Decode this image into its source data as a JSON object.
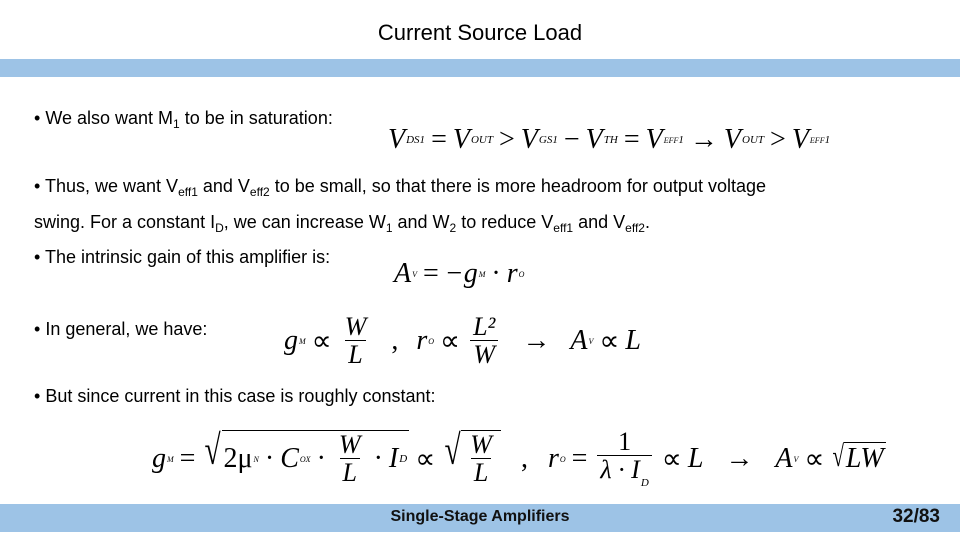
{
  "slide": {
    "title": "Current Source Load",
    "footer_title": "Single-Stage Amplifiers",
    "page_number": "32/83",
    "accent_color": "#9dc3e6"
  },
  "bullets": [
    {
      "bullet": "•",
      "parts": [
        "We also want M",
        "1",
        " to be in saturation:"
      ]
    },
    {
      "bullet": "•",
      "parts": [
        "Thus, we want V",
        "eff1",
        " and V",
        "eff2",
        " to be small, so that there is more headroom for output voltage"
      ]
    },
    {
      "parts": [
        "swing. For a constant I",
        "D",
        ", we can increase W",
        "1",
        " and W",
        "2",
        " to reduce V",
        "eff1",
        " and V",
        "eff2",
        "."
      ]
    },
    {
      "bullet": "•",
      "parts": [
        "The intrinsic gain of this amplifier is:"
      ]
    },
    {
      "bullet": "•",
      "parts": [
        "In general, we have:"
      ]
    },
    {
      "bullet": "•",
      "parts": [
        "But since current in this case is roughly constant:"
      ]
    }
  ],
  "equations": {
    "saturation": {
      "v": "V",
      "ds1": "DS1",
      "eq": "=",
      "out": "OUT",
      "gt": ">",
      "gs1": "GS1",
      "minus": "−",
      "th": "TH",
      "eff1": "eff1",
      "arrow": "→"
    },
    "gain": {
      "a": "A",
      "v": "v",
      "eq": "=",
      "neg": "−g",
      "m": "m",
      "dot": "·",
      "r": "r",
      "o": "o"
    },
    "general": {
      "g": "g",
      "m": "m",
      "prop": "∝",
      "w": "W",
      "l": "L",
      "comma": ",",
      "r": "r",
      "o": "o",
      "l2": "L²",
      "arrow": "→",
      "a": "A",
      "v": "v"
    },
    "constant": {
      "g": "g",
      "m": "m",
      "eq": "=",
      "two_mu": "2μ",
      "n": "n",
      "dot": "·",
      "c": "C",
      "ox": "ox",
      "w": "W",
      "l": "L",
      "i": "I",
      "d": "D",
      "prop": "∝",
      "comma": ",",
      "r": "r",
      "o": "o",
      "one": "1",
      "lambda_i": "λ · I",
      "arrow": "→",
      "a": "A",
      "v": "v",
      "lw": "LW"
    }
  }
}
